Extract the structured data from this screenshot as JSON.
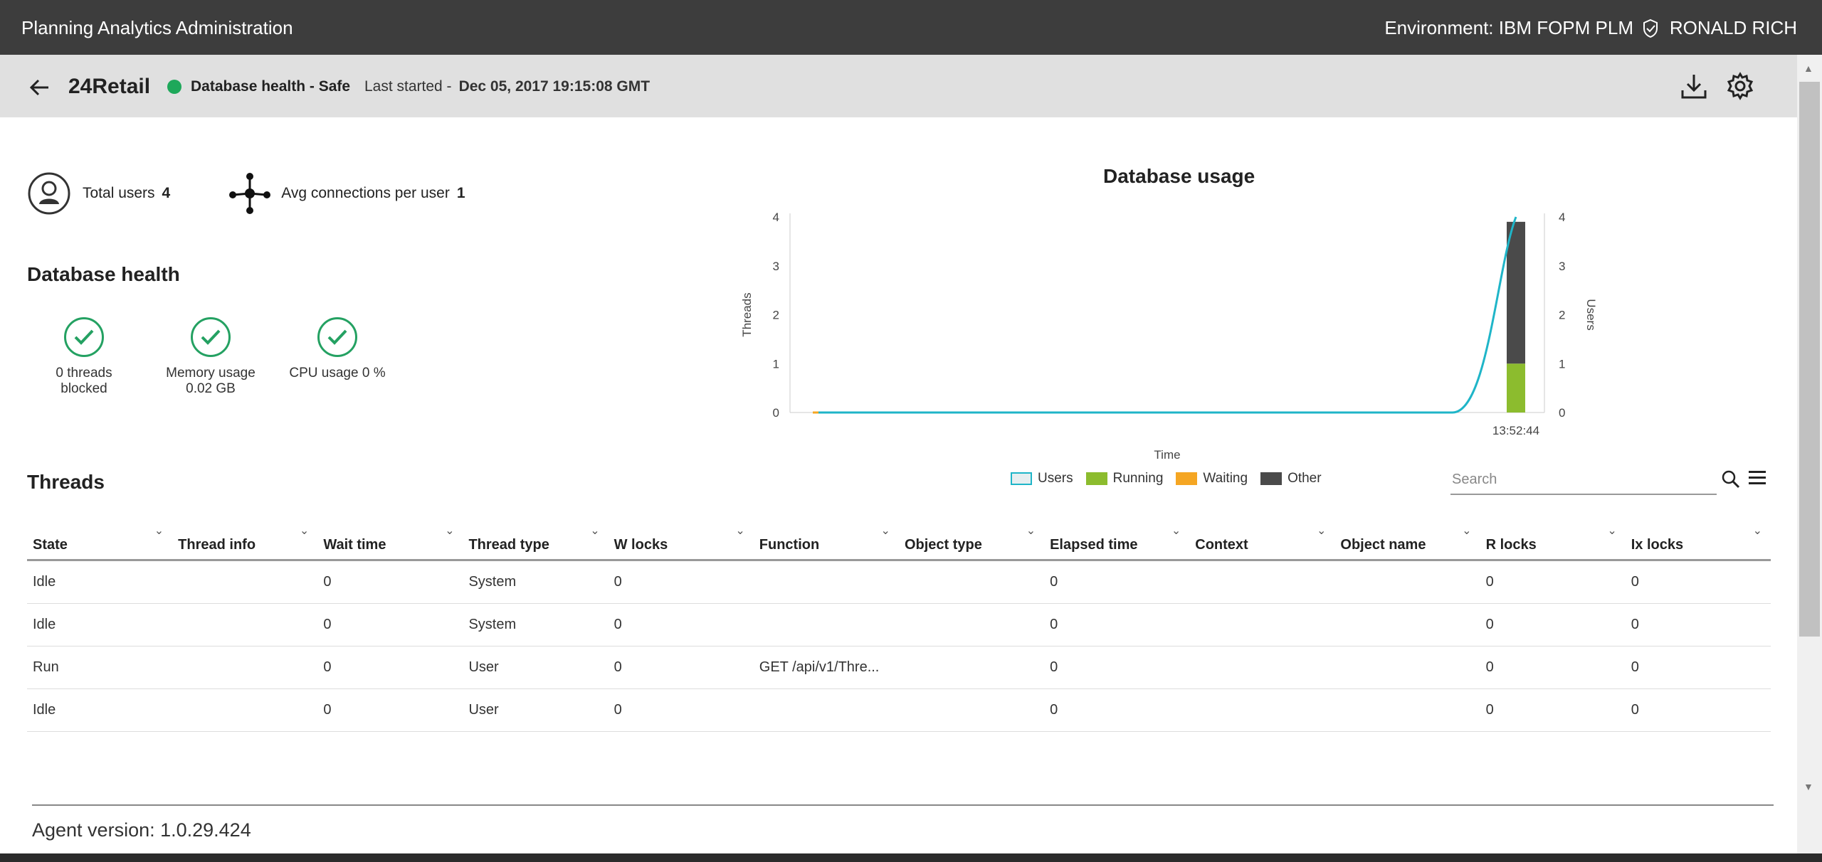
{
  "header": {
    "title": "Planning Analytics Administration",
    "environment": "Environment: IBM FOPM PLM",
    "user": "RONALD RICH"
  },
  "subheader": {
    "db_name": "24Retail",
    "health": "Database health - Safe",
    "health_color": "#1ea85a",
    "last_started_label": "Last started -",
    "last_started_value": "Dec 05, 2017 19:15:08 GMT"
  },
  "stats": {
    "total_users_label": "Total users",
    "total_users_value": "4",
    "avg_conn_label": "Avg connections per user",
    "avg_conn_value": "1"
  },
  "db_health": {
    "title": "Database health",
    "checks": [
      {
        "line1": "0 threads",
        "line2": "blocked"
      },
      {
        "line1": "Memory usage",
        "line2": "0.02 GB"
      },
      {
        "line1": "CPU usage 0 %",
        "line2": ""
      }
    ]
  },
  "chart_data": {
    "type": "bar",
    "title": "Database usage",
    "xlabel": "Time",
    "ylabel": "Threads",
    "y2label": "Users",
    "ylim": [
      0,
      4
    ],
    "y2lim": [
      0,
      4
    ],
    "yticks": [
      "0",
      "1",
      "2",
      "3",
      "4"
    ],
    "categories": [
      "13:52:44"
    ],
    "series": [
      {
        "name": "Running",
        "values": [
          1
        ],
        "color": "#8cbc2e"
      },
      {
        "name": "Waiting",
        "values": [
          0
        ],
        "color": "#f5a623"
      },
      {
        "name": "Other",
        "values": [
          2.9
        ],
        "color": "#4a4a4a"
      }
    ],
    "line_series": {
      "name": "Users",
      "color": "#1fb5c8",
      "values": [
        0,
        0,
        0,
        0,
        0,
        0,
        0,
        0,
        0,
        0,
        0,
        4
      ]
    },
    "legend": [
      "Users",
      "Running",
      "Waiting",
      "Other"
    ]
  },
  "threads": {
    "title": "Threads",
    "search_placeholder": "Search",
    "columns": [
      "State",
      "Thread info",
      "Wait time",
      "Thread type",
      "W locks",
      "Function",
      "Object type",
      "Elapsed time",
      "Context",
      "Object name",
      "R locks",
      "Ix locks"
    ],
    "rows": [
      [
        "Idle",
        "",
        "0",
        "System",
        "0",
        "",
        "",
        "0",
        "",
        "",
        "0",
        "0"
      ],
      [
        "Idle",
        "",
        "0",
        "System",
        "0",
        "",
        "",
        "0",
        "",
        "",
        "0",
        "0"
      ],
      [
        "Run",
        "",
        "0",
        "User",
        "0",
        "GET /api/v1/Thre...",
        "",
        "0",
        "",
        "",
        "0",
        "0"
      ],
      [
        "Idle",
        "",
        "0",
        "User",
        "0",
        "",
        "",
        "0",
        "",
        "",
        "0",
        "0"
      ]
    ]
  },
  "footer": {
    "agent_version": "Agent version: 1.0.29.424"
  }
}
